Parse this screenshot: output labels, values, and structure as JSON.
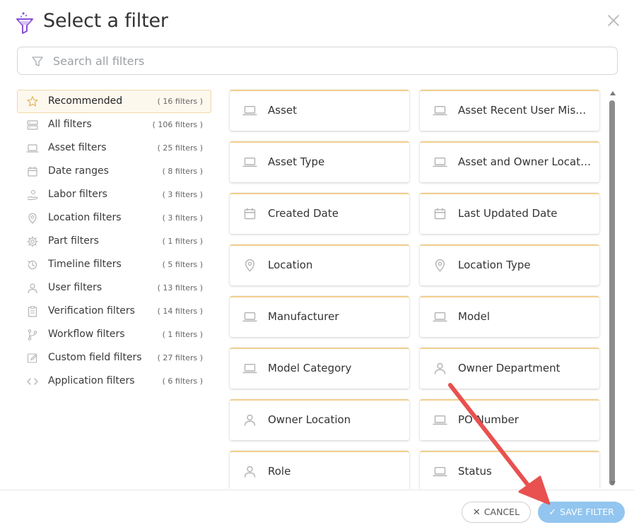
{
  "header": {
    "title": "Select a filter"
  },
  "search": {
    "placeholder": "Search all filters",
    "value": ""
  },
  "sidebar": {
    "items": [
      {
        "label": "Recommended",
        "count": "( 16 filters )",
        "icon": "star-icon",
        "active": true
      },
      {
        "label": "All filters",
        "count": "( 106 filters )",
        "icon": "server-icon"
      },
      {
        "label": "Asset filters",
        "count": "( 25 filters )",
        "icon": "laptop-icon"
      },
      {
        "label": "Date ranges",
        "count": "( 8 filters )",
        "icon": "calendar-icon"
      },
      {
        "label": "Labor filters",
        "count": "( 3 filters )",
        "icon": "hand-money-icon"
      },
      {
        "label": "Location filters",
        "count": "( 3 filters )",
        "icon": "map-pin-icon"
      },
      {
        "label": "Part filters",
        "count": "( 1 filters )",
        "icon": "gear-icon"
      },
      {
        "label": "Timeline filters",
        "count": "( 5 filters )",
        "icon": "history-icon"
      },
      {
        "label": "User filters",
        "count": "( 13 filters )",
        "icon": "user-icon"
      },
      {
        "label": "Verification filters",
        "count": "( 14 filters )",
        "icon": "clipboard-icon"
      },
      {
        "label": "Workflow filters",
        "count": "( 1 filters )",
        "icon": "branch-icon"
      },
      {
        "label": "Custom field filters",
        "count": "( 27 filters )",
        "icon": "edit-icon"
      },
      {
        "label": "Application filters",
        "count": "( 6 filters )",
        "icon": "code-icon"
      }
    ]
  },
  "cards": [
    {
      "label": "Asset",
      "icon": "laptop-icon"
    },
    {
      "label": "Asset Recent User Mismatch",
      "icon": "laptop-icon"
    },
    {
      "label": "Asset Type",
      "icon": "laptop-icon"
    },
    {
      "label": "Asset and Owner Location Mismatch",
      "icon": "laptop-icon"
    },
    {
      "label": "Created Date",
      "icon": "calendar-icon"
    },
    {
      "label": "Last Updated Date",
      "icon": "calendar-icon"
    },
    {
      "label": "Location",
      "icon": "map-pin-icon"
    },
    {
      "label": "Location Type",
      "icon": "map-pin-icon"
    },
    {
      "label": "Manufacturer",
      "icon": "laptop-icon"
    },
    {
      "label": "Model",
      "icon": "laptop-icon"
    },
    {
      "label": "Model Category",
      "icon": "laptop-icon"
    },
    {
      "label": "Owner Department",
      "icon": "user-icon"
    },
    {
      "label": "Owner Location",
      "icon": "user-icon"
    },
    {
      "label": "PO Number",
      "icon": "laptop-icon"
    },
    {
      "label": "Role",
      "icon": "user-icon"
    },
    {
      "label": "Status",
      "icon": "laptop-icon"
    }
  ],
  "footer": {
    "cancel_label": "CANCEL",
    "save_label": "SAVE FILTER"
  },
  "colors": {
    "accent_border": "#f2cf8e",
    "save_button": "#92c5ef",
    "annotation_arrow": "#e8514f",
    "title_icon": "#8a4fd8"
  }
}
